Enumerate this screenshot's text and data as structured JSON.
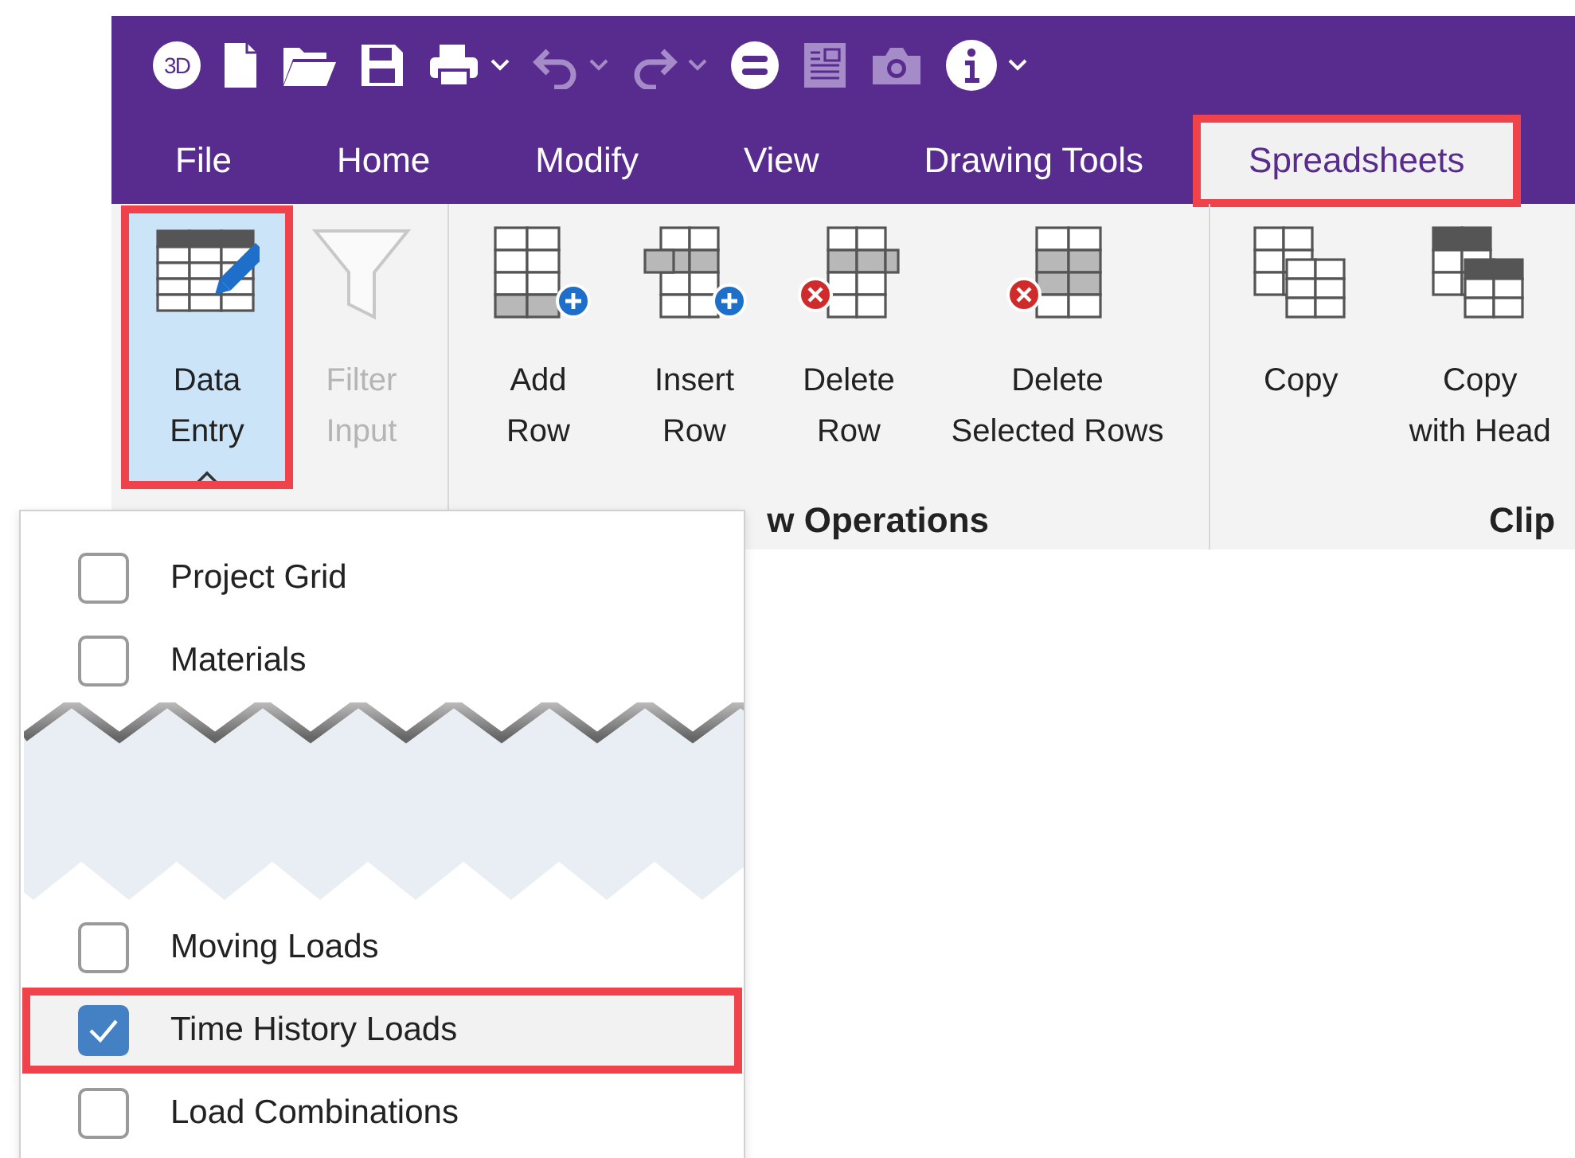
{
  "quick_access": [
    {
      "kind": "logo",
      "label": "3D",
      "disabled": false
    },
    {
      "kind": "new-file",
      "disabled": false
    },
    {
      "kind": "open-folder",
      "disabled": false
    },
    {
      "kind": "save",
      "disabled": false
    },
    {
      "kind": "print",
      "disabled": false
    },
    {
      "kind": "caret",
      "disabled": false
    },
    {
      "kind": "undo",
      "disabled": true
    },
    {
      "kind": "caret",
      "disabled": true
    },
    {
      "kind": "redo",
      "disabled": true
    },
    {
      "kind": "caret",
      "disabled": true
    },
    {
      "kind": "equals",
      "disabled": false
    },
    {
      "kind": "form",
      "disabled": true
    },
    {
      "kind": "camera",
      "disabled": true
    },
    {
      "kind": "info",
      "disabled": false
    },
    {
      "kind": "caret",
      "disabled": false
    }
  ],
  "tabs": [
    {
      "label": "File",
      "selected": false,
      "highlighted": false
    },
    {
      "label": "Home",
      "selected": false,
      "highlighted": false
    },
    {
      "label": "Modify",
      "selected": false,
      "highlighted": false
    },
    {
      "label": "View",
      "selected": false,
      "highlighted": false
    },
    {
      "label": "Drawing Tools",
      "selected": false,
      "highlighted": false
    },
    {
      "label": "Spreadsheets",
      "selected": true,
      "highlighted": true
    }
  ],
  "ribbon_groups": [
    {
      "buttons": [
        {
          "kind": "data-entry",
          "lines": [
            "Data",
            "Entry"
          ],
          "disabled": false,
          "active": true,
          "highlighted": true,
          "expanded": true
        },
        {
          "kind": "filter",
          "lines": [
            "Filter",
            "Input"
          ],
          "disabled": true,
          "active": false,
          "highlighted": false,
          "expanded": false
        }
      ]
    },
    {
      "label": "w Operations",
      "buttons": [
        {
          "kind": "add-row",
          "lines": [
            "Add",
            "Row"
          ],
          "disabled": false,
          "active": false,
          "highlighted": false,
          "expanded": false
        },
        {
          "kind": "insert-row",
          "lines": [
            "Insert",
            "Row"
          ],
          "disabled": false,
          "active": false,
          "highlighted": false,
          "expanded": false
        },
        {
          "kind": "delete-row",
          "lines": [
            "Delete",
            "Row"
          ],
          "disabled": false,
          "active": false,
          "highlighted": false,
          "expanded": false
        },
        {
          "kind": "delete-selected",
          "lines": [
            "Delete",
            "Selected Rows"
          ],
          "disabled": false,
          "active": false,
          "highlighted": false,
          "expanded": false
        }
      ]
    },
    {
      "label": "Clip",
      "buttons": [
        {
          "kind": "copy",
          "lines": [
            "Copy"
          ],
          "disabled": false,
          "active": false,
          "highlighted": false,
          "expanded": false
        },
        {
          "kind": "copy-headers",
          "lines": [
            "Copy",
            "with Head"
          ],
          "disabled": false,
          "active": false,
          "highlighted": false,
          "expanded": false
        }
      ]
    }
  ],
  "dropdown": {
    "items": [
      {
        "kind": "check",
        "label": "Project Grid",
        "checked": false,
        "highlighted": false
      },
      {
        "kind": "check",
        "label": "Materials",
        "checked": false,
        "highlighted": false
      },
      {
        "kind": "tear"
      },
      {
        "kind": "check",
        "label": "Moving Loads",
        "checked": false,
        "highlighted": false
      },
      {
        "kind": "check",
        "label": "Time History Loads",
        "checked": true,
        "highlighted": true
      },
      {
        "kind": "check",
        "label": "Load Combinations",
        "checked": false,
        "highlighted": false
      }
    ]
  }
}
